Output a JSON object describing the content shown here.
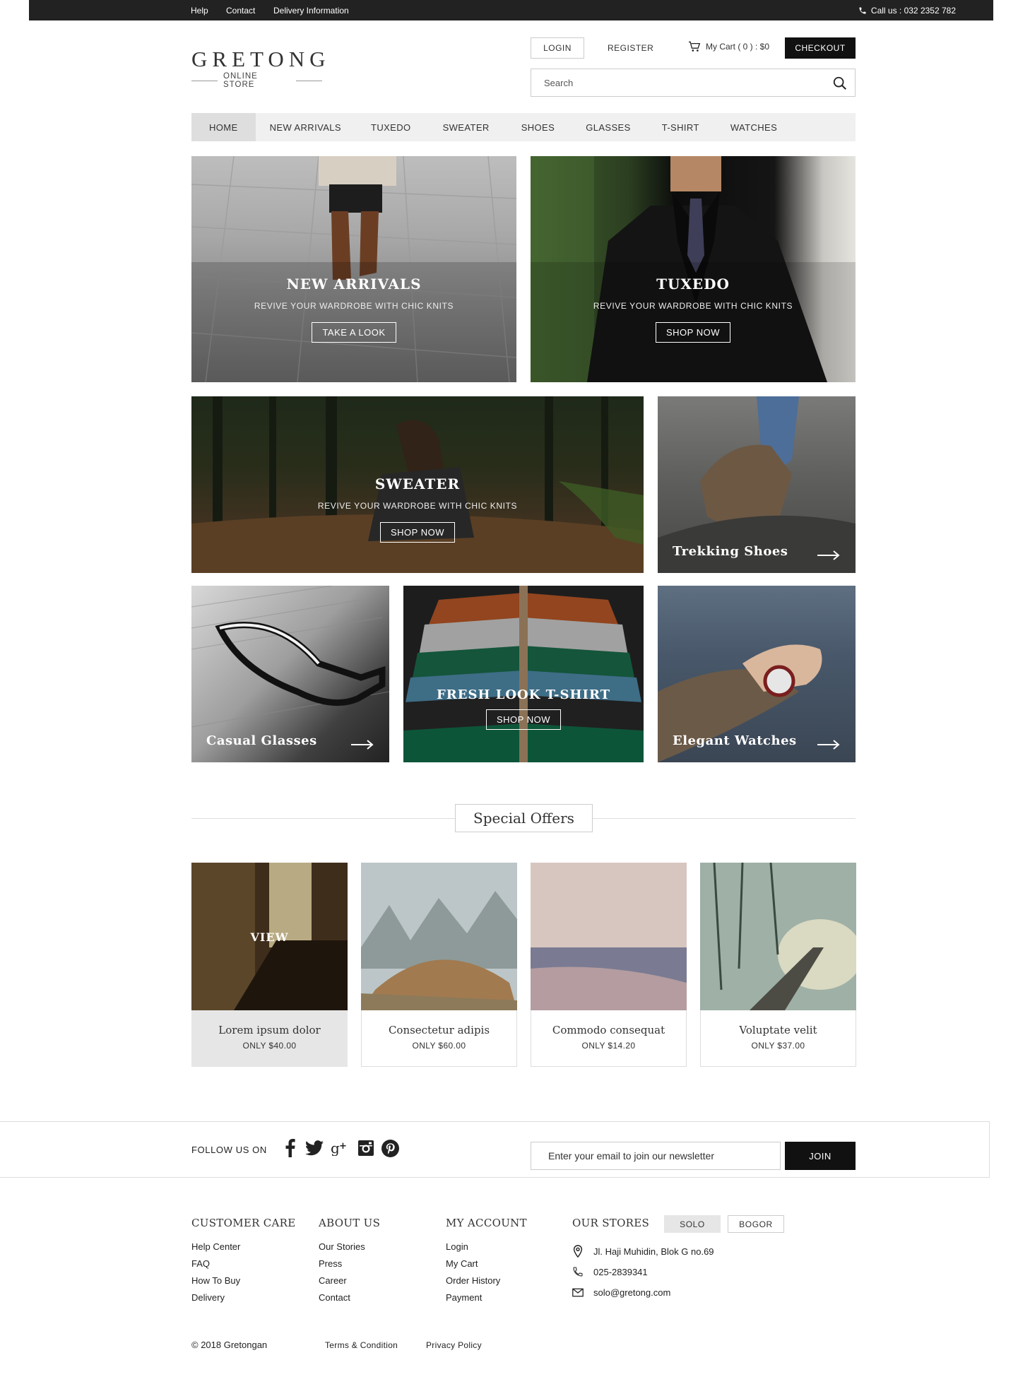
{
  "topbar": {
    "links": [
      "Help",
      "Contact",
      "Delivery Information"
    ],
    "phone": "Call us : 032 2352 782"
  },
  "brand": {
    "name": "GRETONG",
    "tagline": "ONLINE STORE"
  },
  "header": {
    "login": "LOGIN",
    "register": "REGISTER",
    "cart": "My Cart ( 0 ) : $0",
    "checkout": "CHECKOUT",
    "search_placeholder": "Search"
  },
  "nav": [
    "HOME",
    "NEW ARRIVALS",
    "TUXEDO",
    "SWEATER",
    "SHOES",
    "GLASSES",
    "T-SHIRT",
    "WATCHES"
  ],
  "tiles": {
    "new_arrivals": {
      "title": "NEW ARRIVALS",
      "subtitle": "REVIVE YOUR WARDROBE WITH CHIC KNITS",
      "button": "TAKE A LOOK"
    },
    "tuxedo": {
      "title": "TUXEDO",
      "subtitle": "REVIVE YOUR WARDROBE WITH CHIC KNITS",
      "button": "SHOP NOW"
    },
    "sweater": {
      "title": "SWEATER",
      "subtitle": "REVIVE YOUR WARDROBE WITH CHIC KNITS",
      "button": "SHOP NOW"
    },
    "shoes": {
      "title": "Trekking Shoes"
    },
    "glasses": {
      "title": "Casual Glasses"
    },
    "tshirt": {
      "title": "FRESH LOOK T-SHIRT",
      "button": "SHOP NOW"
    },
    "watches": {
      "title": "Elegant Watches"
    }
  },
  "offers": {
    "title": "Special Offers",
    "hover_label": "VIEW",
    "items": [
      {
        "name": "Lorem ipsum dolor",
        "price": "ONLY $40.00"
      },
      {
        "name": "Consectetur adipis",
        "price": "ONLY $60.00"
      },
      {
        "name": "Commodo consequat",
        "price": "ONLY $14.20"
      },
      {
        "name": "Voluptate velit",
        "price": "ONLY $37.00"
      }
    ]
  },
  "follow": {
    "label": "FOLLOW US ON",
    "icons": [
      "facebook-icon",
      "twitter-icon",
      "google-plus-icon",
      "instagram-icon",
      "pinterest-icon"
    ],
    "newsletter_placeholder": "Enter your email to join our newsletter",
    "join": "JOIN"
  },
  "footer": {
    "customer_care": {
      "title": "CUSTOMER CARE",
      "links": [
        "Help Center",
        "FAQ",
        "How To Buy",
        "Delivery"
      ]
    },
    "about_us": {
      "title": "ABOUT US",
      "links": [
        "Our Stories",
        "Press",
        "Career",
        "Contact"
      ]
    },
    "my_account": {
      "title": "MY ACCOUNT",
      "links": [
        "Login",
        "My Cart",
        "Order History",
        "Payment"
      ]
    },
    "stores": {
      "title": "OUR STORES",
      "tabs": [
        "SOLO",
        "BOGOR"
      ],
      "address": "Jl. Haji Muhidin, Blok G no.69",
      "phone": "025-2839341",
      "email": "solo@gretong.com"
    },
    "copyright": "© 2018 Gretongan",
    "terms": "Terms & Condition",
    "privacy": "Privacy Policy"
  }
}
